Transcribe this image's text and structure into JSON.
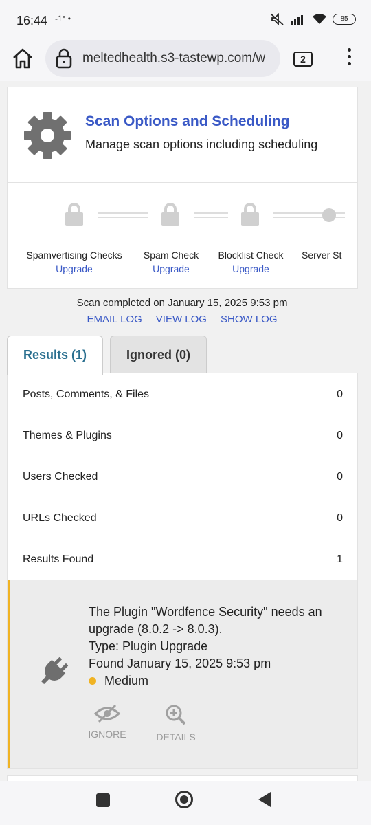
{
  "status_bar": {
    "time": "16:44",
    "extra": "-1° •",
    "battery": "85"
  },
  "browser": {
    "url": "meltedhealth.s3-tastewp.com/w",
    "tab_count": "2"
  },
  "scan_card": {
    "title": "Scan Options and Scheduling",
    "subtitle": "Manage scan options including scheduling"
  },
  "checks": [
    {
      "label": "Spamvertising Checks",
      "link": "Upgrade"
    },
    {
      "label": "Spam Check",
      "link": "Upgrade"
    },
    {
      "label": "Blocklist Check",
      "link": "Upgrade"
    },
    {
      "label": "Server St",
      "link": ""
    }
  ],
  "scan_status": {
    "completed": "Scan completed on January 15, 2025 9:53 pm",
    "links": [
      "EMAIL LOG",
      "VIEW LOG",
      "SHOW LOG"
    ]
  },
  "tabs": {
    "results": "Results (1)",
    "ignored": "Ignored (0)"
  },
  "stats": [
    {
      "label": "Posts, Comments, & Files",
      "value": "0"
    },
    {
      "label": "Themes & Plugins",
      "value": "0"
    },
    {
      "label": "Users Checked",
      "value": "0"
    },
    {
      "label": "URLs Checked",
      "value": "0"
    },
    {
      "label": "Results Found",
      "value": "1"
    }
  ],
  "issue": {
    "message": "The Plugin \"Wordfence Security\" needs an upgrade (8.0.2 -> 8.0.3).",
    "type": "Type: Plugin Upgrade",
    "found": "Found January 15, 2025 9:53 pm",
    "severity": "Medium",
    "severity_color": "#f0b323",
    "actions": {
      "ignore": "IGNORE",
      "details": "DETAILS"
    }
  },
  "colors": {
    "link": "#3a59c6",
    "tab_active": "#2a6f8f",
    "warning": "#f0b323"
  }
}
